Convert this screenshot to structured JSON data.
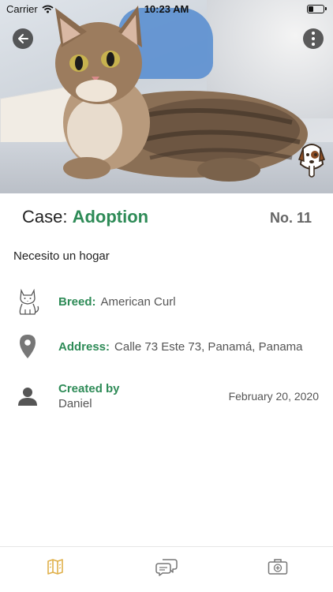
{
  "status_bar": {
    "carrier": "Carrier",
    "time": "10:23 AM",
    "battery_level": 0.35
  },
  "header_actions": {
    "back_icon": "arrow-left-icon",
    "more_icon": "vertical-dots-icon",
    "logo_icon": "dog-face-icon"
  },
  "case": {
    "prefix": "Case: ",
    "type": "Adoption",
    "number": "No. 11",
    "description": "Necesito un hogar"
  },
  "details": {
    "breed_label": "Breed:",
    "breed_value": "American Curl",
    "address_label": "Address:",
    "address_value": "Calle 73 Este 73, Panamá, Panama",
    "created_label": "Created by",
    "created_value": "Daniel",
    "created_date": "February 20, 2020"
  },
  "tab_bar": {
    "items": [
      {
        "icon": "map-icon",
        "active": true
      },
      {
        "icon": "chat-bubbles-icon",
        "active": false
      },
      {
        "icon": "vet-kit-icon",
        "active": false
      }
    ]
  },
  "colors": {
    "accent": "#2e8b57",
    "tab_active": "#e0b04a",
    "tab_inactive": "#777777"
  }
}
